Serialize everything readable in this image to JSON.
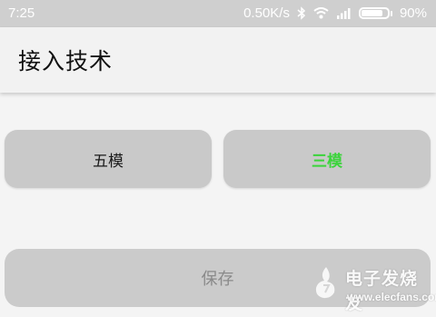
{
  "status_bar": {
    "time": "7:25",
    "network_speed": "0.50K/s",
    "battery_percent": "90%",
    "battery_level": 0.9,
    "icons": [
      "bluetooth-icon",
      "wifi-icon",
      "signal-icon",
      "battery-icon"
    ]
  },
  "app_bar": {
    "title": "接入技术"
  },
  "options": {
    "five_mode": {
      "label": "五模",
      "color": "#1a1a1a"
    },
    "three_mode": {
      "label": "三模",
      "color": "#3bd43b",
      "selected": true
    }
  },
  "save": {
    "label": "保存",
    "enabled": false
  },
  "watermark": {
    "cn_text": "电子发烧友",
    "en_text": "www.elecfans.com"
  }
}
